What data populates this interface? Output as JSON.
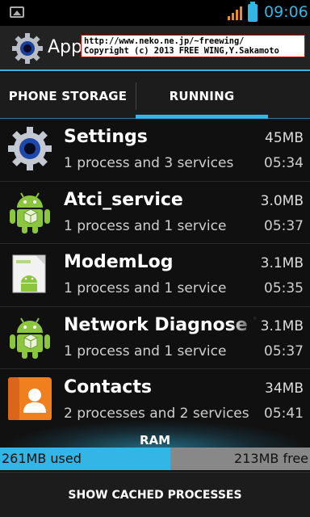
{
  "status_bar": {
    "time": "09:06"
  },
  "action_bar": {
    "title": "Apps"
  },
  "watermark": {
    "line1": "http://www.neko.ne.jp/~freewing/",
    "line2": "Copyright (c) 2013 FREE WING,Y.Sakamoto"
  },
  "tabs": [
    {
      "label": "PHONE STORAGE",
      "selected": false
    },
    {
      "label": "RUNNING",
      "selected": true
    }
  ],
  "accent_color": "#33b5e5",
  "apps": [
    {
      "name": "Settings",
      "size": "45MB",
      "desc": "1 process and 3 services",
      "time": "05:34",
      "icon": "settings-gear-icon"
    },
    {
      "name": "Atci_service",
      "size": "3.0MB",
      "desc": "1 process and 1 service",
      "time": "05:37",
      "icon": "android-icon"
    },
    {
      "name": "ModemLog",
      "size": "3.1MB",
      "desc": "1 process and 1 service",
      "time": "05:35",
      "icon": "android-package-icon"
    },
    {
      "name": "Network Diagnose Tool",
      "size": "3.1MB",
      "desc": "1 process and 1 service",
      "time": "05:37",
      "icon": "android-icon"
    },
    {
      "name": "Contacts",
      "size": "34MB",
      "desc": "2 processes and 2 services",
      "time": "05:41",
      "icon": "contacts-icon"
    }
  ],
  "ram": {
    "label": "RAM",
    "used": "261MB used",
    "free": "213MB free",
    "used_fraction": 0.55
  },
  "cached_button": {
    "label": "SHOW CACHED PROCESSES"
  }
}
